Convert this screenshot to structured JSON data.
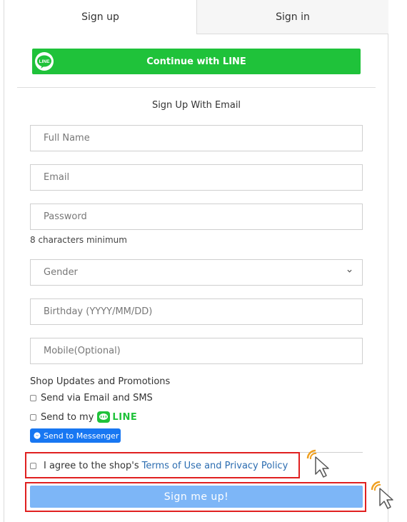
{
  "tabs": [
    {
      "label": "Sign up",
      "active": true
    },
    {
      "label": "Sign in",
      "active": false
    }
  ],
  "line_button": {
    "label": "Continue with LINE",
    "logo_text": "LINE",
    "color": "#1fc23a"
  },
  "form": {
    "heading": "Sign Up With Email",
    "full_name_placeholder": "Full Name",
    "email_placeholder": "Email",
    "password_placeholder": "Password",
    "password_hint": "8 characters minimum",
    "gender_label": "Gender",
    "birthday_placeholder": "Birthday (YYYY/MM/DD)",
    "mobile_placeholder": "Mobile(Optional)"
  },
  "updates": {
    "title": "Shop Updates and Promotions",
    "email_sms_label": "Send via Email and SMS",
    "send_to_my_label": "Send to my",
    "line_word": "LINE",
    "messenger_label": "Send to Messenger"
  },
  "agreement": {
    "prefix": "I agree to the shop's",
    "link_text": "Terms of Use and Privacy Policy"
  },
  "submit": {
    "label": "Sign me up!",
    "color": "#7db6f7"
  },
  "icons": {
    "line_logo": "line-logo-icon",
    "dropdown": "chevron-down-icon",
    "messenger": "messenger-icon",
    "cursor": "click-pointer-icon"
  },
  "highlight_color": "#e02020"
}
